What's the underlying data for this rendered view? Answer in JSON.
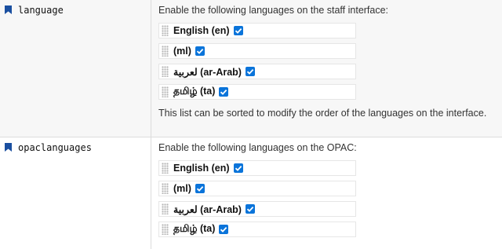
{
  "prefs": [
    {
      "name": "language",
      "description": "Enable the following languages on the staff interface:",
      "languages": [
        {
          "label": "English (en)",
          "checked": true
        },
        {
          "label": "(ml)",
          "checked": true
        },
        {
          "label": "لعربية (ar-Arab)",
          "checked": true
        },
        {
          "label": "தமிழ் (ta)",
          "checked": true
        }
      ],
      "note": "This list can be sorted to modify the order of the languages on the interface."
    },
    {
      "name": "opaclanguages",
      "description": "Enable the following languages on the OPAC:",
      "languages": [
        {
          "label": "English (en)",
          "checked": true
        },
        {
          "label": "(ml)",
          "checked": true
        },
        {
          "label": "لعربية (ar-Arab)",
          "checked": true
        },
        {
          "label": "தமிழ் (ta)",
          "checked": true
        }
      ]
    }
  ],
  "colors": {
    "accent": "#0a74da",
    "bookmark": "#1a4fa0"
  },
  "icons": {
    "bookmark": "bookmark-icon",
    "drag": "drag-handle-icon",
    "check": "checkbox-checked-icon"
  }
}
